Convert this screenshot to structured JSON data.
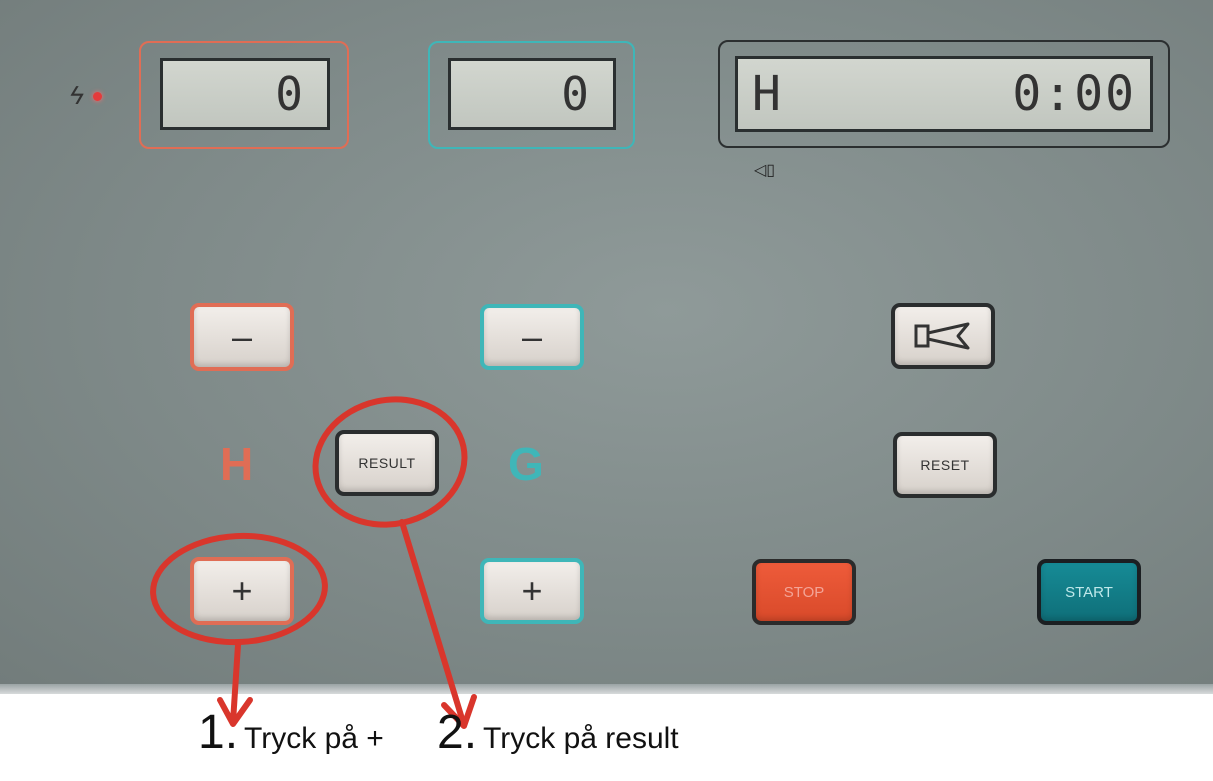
{
  "displays": {
    "home_score": "0",
    "guest_score": "0",
    "main_left": "H",
    "main_right": "0:00"
  },
  "buttons": {
    "home_minus": "–",
    "home_plus": "+",
    "guest_minus": "–",
    "guest_plus": "+",
    "result": "RESULT",
    "reset": "RESET",
    "stop": "STOP",
    "start": "START"
  },
  "team_labels": {
    "home": "H",
    "guest": "G"
  },
  "instructions": [
    {
      "number": "1.",
      "text": "Tryck på +"
    },
    {
      "number": "2.",
      "text": "Tryck på result"
    }
  ],
  "colors": {
    "home_accent": "#e06d55",
    "guest_accent": "#3fb6b8",
    "highlight_red": "#d9362c",
    "stop": "#ee5b3a",
    "start": "#168b96"
  }
}
